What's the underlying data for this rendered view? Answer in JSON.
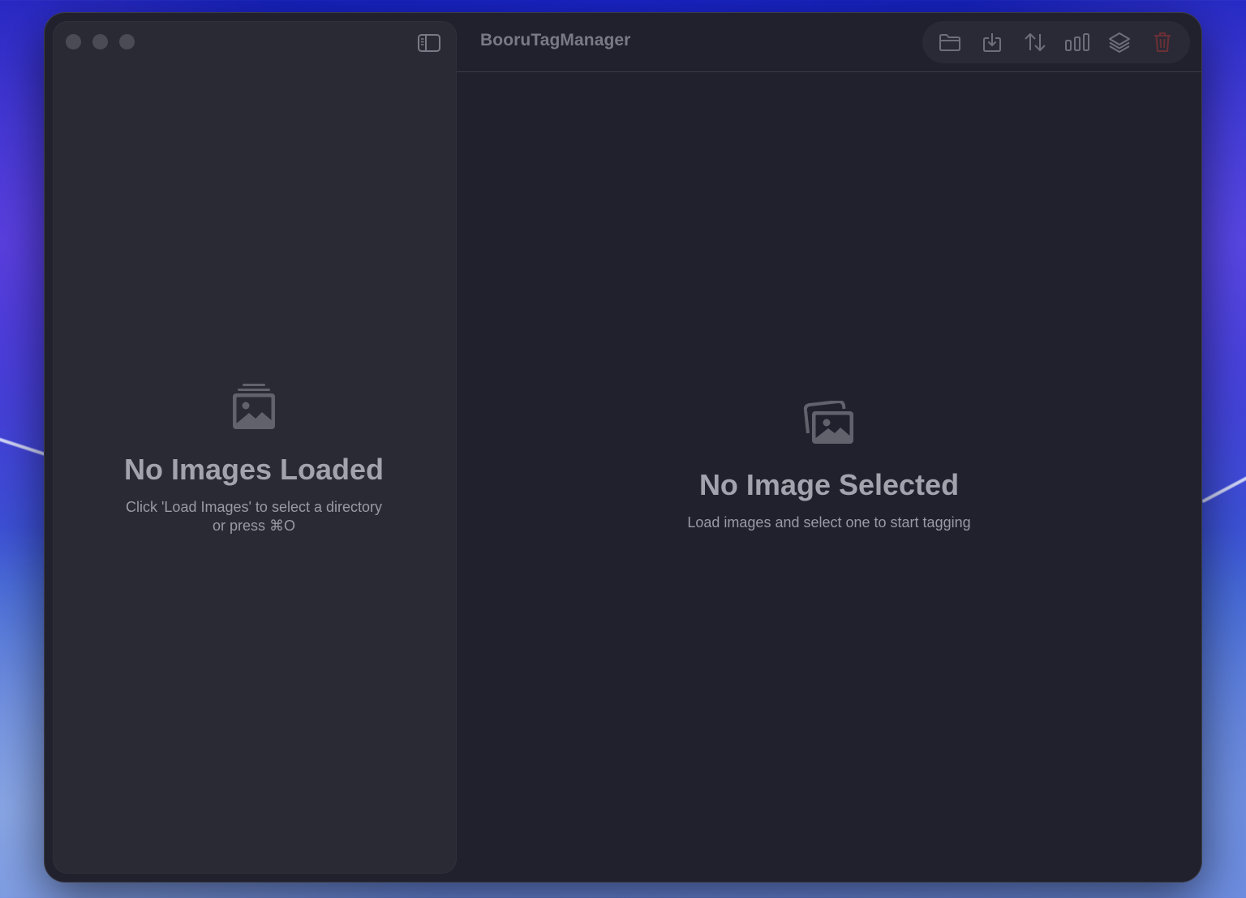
{
  "window": {
    "title": "BooruTagManager"
  },
  "toolbar": {
    "buttons": [
      {
        "name": "open-folder",
        "icon": "folder-icon"
      },
      {
        "name": "export",
        "icon": "download-icon"
      },
      {
        "name": "sort",
        "icon": "sort-arrows-icon"
      },
      {
        "name": "statistics",
        "icon": "bar-chart-icon"
      },
      {
        "name": "layers",
        "icon": "layers-icon"
      },
      {
        "name": "delete",
        "icon": "trash-icon",
        "color": "#6b2f35"
      }
    ]
  },
  "sidebar": {
    "empty_state": {
      "icon": "photo-stack-icon",
      "title": "No Images Loaded",
      "subtitle_line1": "Click 'Load Images' to select a directory",
      "subtitle_line2": "or press ⌘O"
    }
  },
  "detail": {
    "empty_state": {
      "icon": "photos-icon",
      "title": "No Image Selected",
      "subtitle": "Load images and select one to start tagging"
    }
  },
  "colors": {
    "window_bg": "#21212e",
    "sidebar_bg": "#2a2a35",
    "icon_gray": "#6f6f7a",
    "delete_red": "#6b2f35"
  }
}
